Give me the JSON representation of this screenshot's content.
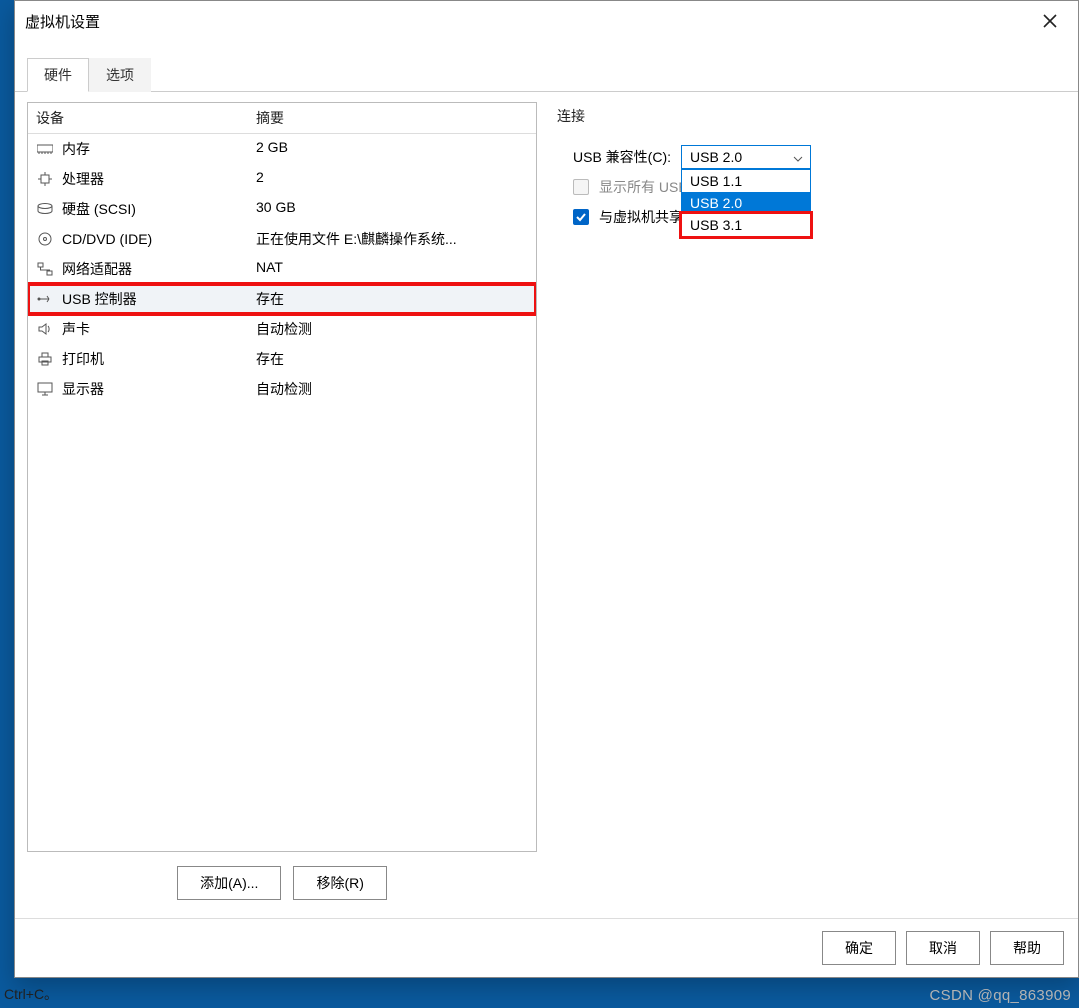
{
  "window": {
    "title": "虚拟机设置"
  },
  "tabs": {
    "hardware": "硬件",
    "options": "选项"
  },
  "device_table": {
    "header_device": "设备",
    "header_summary": "摘要",
    "rows": [
      {
        "name": "内存",
        "summary": "2 GB",
        "icon": "memory"
      },
      {
        "name": "处理器",
        "summary": "2",
        "icon": "cpu"
      },
      {
        "name": "硬盘 (SCSI)",
        "summary": "30 GB",
        "icon": "disk"
      },
      {
        "name": "CD/DVD (IDE)",
        "summary": "正在使用文件 E:\\麒麟操作系统...",
        "icon": "cd"
      },
      {
        "name": "网络适配器",
        "summary": "NAT",
        "icon": "net"
      },
      {
        "name": "USB 控制器",
        "summary": "存在",
        "icon": "usb"
      },
      {
        "name": "声卡",
        "summary": "自动检测",
        "icon": "sound"
      },
      {
        "name": "打印机",
        "summary": "存在",
        "icon": "printer"
      },
      {
        "name": "显示器",
        "summary": "自动检测",
        "icon": "display"
      }
    ]
  },
  "buttons": {
    "add": "添加(A)...",
    "remove": "移除(R)",
    "ok": "确定",
    "cancel": "取消",
    "help": "帮助"
  },
  "connection": {
    "group_label": "连接",
    "compat_label": "USB 兼容性(C):",
    "compat_selected": "USB 2.0",
    "compat_options": [
      "USB 1.1",
      "USB 2.0",
      "USB 3.1"
    ],
    "show_all_label": "显示所有 USB",
    "share_label": "与虚拟机共享"
  },
  "watermark": "CSDN @qq_863909",
  "bgtext": "Ctrl+C。"
}
